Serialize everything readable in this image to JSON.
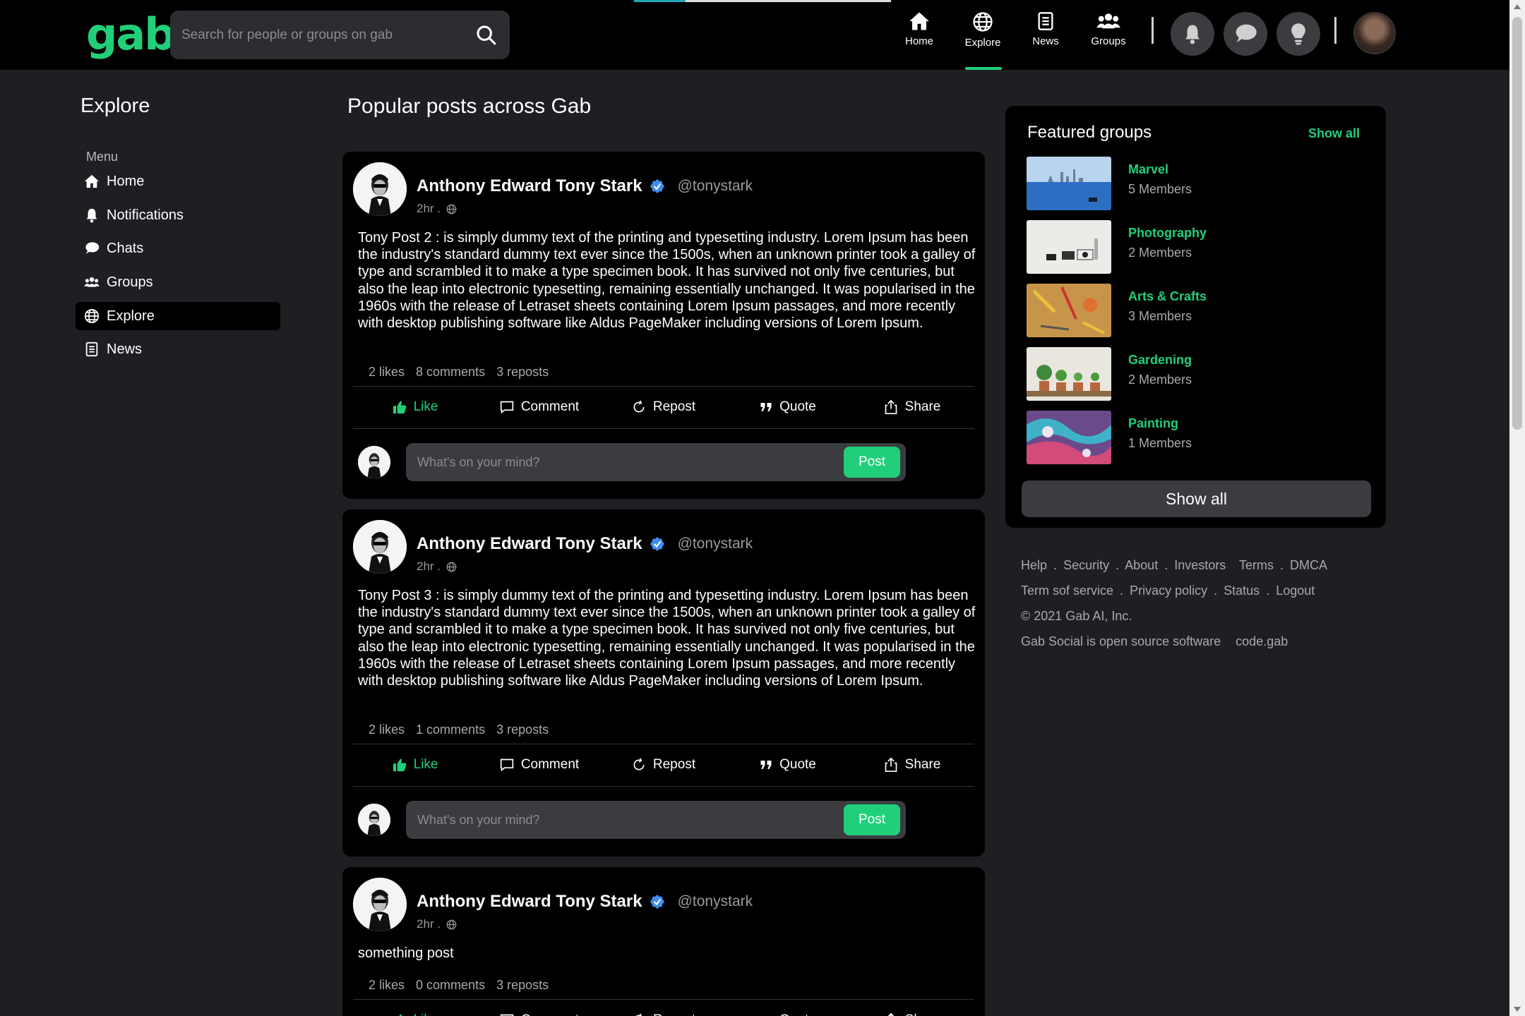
{
  "header": {
    "logo": "gab",
    "search_placeholder": "Search for people or groups on gab",
    "nav": [
      {
        "label": "Home",
        "icon": "home-icon"
      },
      {
        "label": "Explore",
        "icon": "globe-icon",
        "active": true
      },
      {
        "label": "News",
        "icon": "news-icon"
      },
      {
        "label": "Groups",
        "icon": "groups-icon"
      }
    ],
    "icon_buttons": [
      "bell-icon",
      "chat-icon",
      "lightbulb-icon"
    ]
  },
  "sidebar": {
    "title": "Explore",
    "menu_label": "Menu",
    "items": [
      {
        "label": "Home",
        "icon": "home-icon"
      },
      {
        "label": "Notifications",
        "icon": "bell-icon"
      },
      {
        "label": "Chats",
        "icon": "chat-icon"
      },
      {
        "label": "Groups",
        "icon": "groups-icon"
      },
      {
        "label": "Explore",
        "icon": "globe-icon",
        "active": true
      },
      {
        "label": "News",
        "icon": "news-icon"
      }
    ]
  },
  "main": {
    "title": "Popular posts across Gab",
    "posts": [
      {
        "author": "Anthony Edward Tony Stark",
        "handle": "@tonystark",
        "time": "2hr .",
        "body": "Tony Post 2 : is simply dummy text of the printing and typesetting industry. Lorem Ipsum has been the industry's standard dummy text ever since the 1500s, when an unknown printer took a galley of type and scrambled it to make a type specimen book. It has survived not only five centuries, but also the leap into electronic typesetting, remaining essentially unchanged. It was popularised in the 1960s with the release of Letraset sheets containing Lorem Ipsum passages, and more recently with desktop publishing software like Aldus PageMaker including versions of Lorem Ipsum.",
        "likes": "2 likes",
        "comments": "8 comments",
        "reposts": "3 reposts"
      },
      {
        "author": "Anthony Edward Tony Stark",
        "handle": "@tonystark",
        "time": "2hr .",
        "body": "Tony Post 3 : is simply dummy text of the printing and typesetting industry. Lorem Ipsum has been the industry's standard dummy text ever since the 1500s, when an unknown printer took a galley of type and scrambled it to make a type specimen book. It has survived not only five centuries, but also the leap into electronic typesetting, remaining essentially unchanged. It was popularised in the 1960s with the release of Letraset sheets containing Lorem Ipsum passages, and more recently with desktop publishing software like Aldus PageMaker including versions of Lorem Ipsum.",
        "likes": "2 likes",
        "comments": "1 comments",
        "reposts": "3 reposts"
      },
      {
        "author": "Anthony Edward Tony Stark",
        "handle": "@tonystark",
        "time": "2hr .",
        "body": "something post",
        "likes": "2 likes",
        "comments": "0 comments",
        "reposts": "3 reposts"
      }
    ],
    "actions": {
      "like": "Like",
      "comment": "Comment",
      "repost": "Repost",
      "quote": "Quote",
      "share": "Share"
    },
    "composer": {
      "placeholder": "What's on your mind?",
      "button": "Post"
    }
  },
  "featured_groups": {
    "title": "Featured groups",
    "show_all_link": "Show all",
    "items": [
      {
        "name": "Marvel",
        "members": "5 Members"
      },
      {
        "name": "Photography",
        "members": "2 Members"
      },
      {
        "name": "Arts & Crafts",
        "members": "3 Members"
      },
      {
        "name": "Gardening",
        "members": "2 Members"
      },
      {
        "name": "Painting",
        "members": "1 Members"
      }
    ],
    "show_all_button": "Show all"
  },
  "footer": {
    "links_row1": [
      "Help",
      ".",
      "Security",
      ".",
      "About",
      ".",
      "Investors",
      "Terms",
      ".",
      "DMCA"
    ],
    "links_row2": [
      "Term sof service",
      ".",
      "Privacy policy",
      ".",
      "Status",
      ".",
      "Logout"
    ],
    "copyright": "© 2021 Gab AI, Inc.",
    "open_source": "Gab Social is open source software",
    "code_link": "code.gab"
  },
  "colors": {
    "accent": "#21cf7a",
    "background": "#1d1f23",
    "card": "#000000"
  }
}
